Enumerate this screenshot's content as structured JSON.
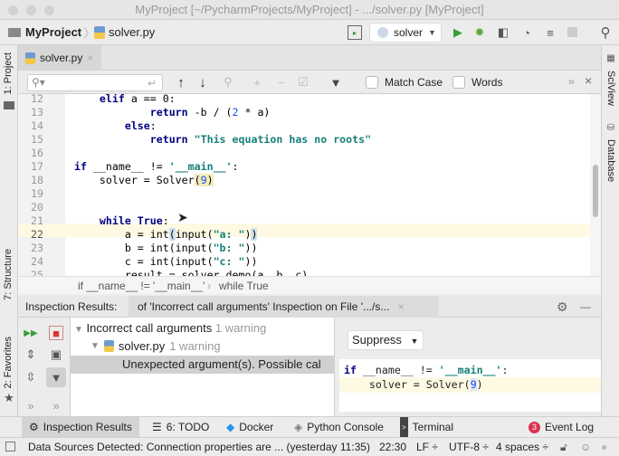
{
  "window": {
    "title": "MyProject [~/PycharmProjects/MyProject] - .../solver.py [MyProject]"
  },
  "navbar": {
    "project": "MyProject",
    "file": "solver.py",
    "run_config": "solver"
  },
  "left_strip": {
    "project": "1: Project",
    "structure": "7: Structure",
    "favorites": "2: Favorites"
  },
  "right_strip": {
    "sciview": "SciView",
    "database": "Database"
  },
  "editor_tab": {
    "label": "solver.py"
  },
  "search": {
    "placeholder": "",
    "match_case": "Match Case",
    "words": "Words"
  },
  "code": {
    "lines": [
      {
        "n": "12",
        "html": "    <span class='kw'>elif</span> a == 0:"
      },
      {
        "n": "13",
        "html": "            <span class='kw'>return</span> -b / (<span class='num'>2</span> * a)"
      },
      {
        "n": "14",
        "html": "        <span class='kw'>else</span>:"
      },
      {
        "n": "15",
        "html": "            <span class='kw'>return</span> <span class='str'>\"This equation has no roots\"</span>"
      },
      {
        "n": "16",
        "html": ""
      },
      {
        "n": "17",
        "html": "<span class='kw'>if</span> __name__ != <span class='str'>'__main__'</span>:"
      },
      {
        "n": "18",
        "html": "    solver = Solver<span style='background:#f6ebbc'>(<span class='num'>9</span>)</span>"
      },
      {
        "n": "19",
        "html": ""
      },
      {
        "n": "20",
        "html": ""
      },
      {
        "n": "21",
        "html": "    <span class='kw'>while True</span>:"
      },
      {
        "n": "22",
        "html": "        a = int<span style='background:#cfe3f0'>(</span>input(<span class='str'>\"a: \"</span>)<span style='background:#cfe3f0'>)</span>"
      },
      {
        "n": "23",
        "html": "        b = int(input(<span class='str'>\"b: \"</span>))"
      },
      {
        "n": "24",
        "html": "        c = int(input(<span class='str'>\"c: \"</span>))"
      },
      {
        "n": "25",
        "html": "        result = solver.demo(a, b, c)"
      }
    ]
  },
  "breadcrumb": {
    "first": "if __name__ != '__main__'",
    "second": "while True"
  },
  "inspection": {
    "label": "Inspection Results:",
    "tab": "of 'Incorrect call arguments' Inspection on File '.../s...",
    "tree": [
      {
        "label": "Incorrect call arguments",
        "count": "1 warning"
      },
      {
        "label": "solver.py",
        "count": "1 warning"
      },
      {
        "label": "Unexpected argument(s). Possible cal"
      }
    ],
    "suppress": "Suppress",
    "preview_line1_kw": "if",
    "preview_line1": " __name__ != ",
    "preview_line1_str": "'__main__'",
    "preview_line1_end": ":",
    "preview_line2": "    solver = Solver(",
    "preview_line2_num": "9",
    "preview_line2_end": ")"
  },
  "tool_windows": {
    "inspection": "Inspection Results",
    "todo": "6: TODO",
    "docker": "Docker",
    "console": "Python Console",
    "terminal": "Terminal",
    "event_count": "3",
    "event_log": "Event Log"
  },
  "status": {
    "message": "Data Sources Detected: Connection properties are ... (yesterday 11:35)",
    "position": "22:30",
    "line_sep": "LF ÷",
    "encoding": "UTF-8 ÷",
    "indent": "4 spaces ÷"
  }
}
